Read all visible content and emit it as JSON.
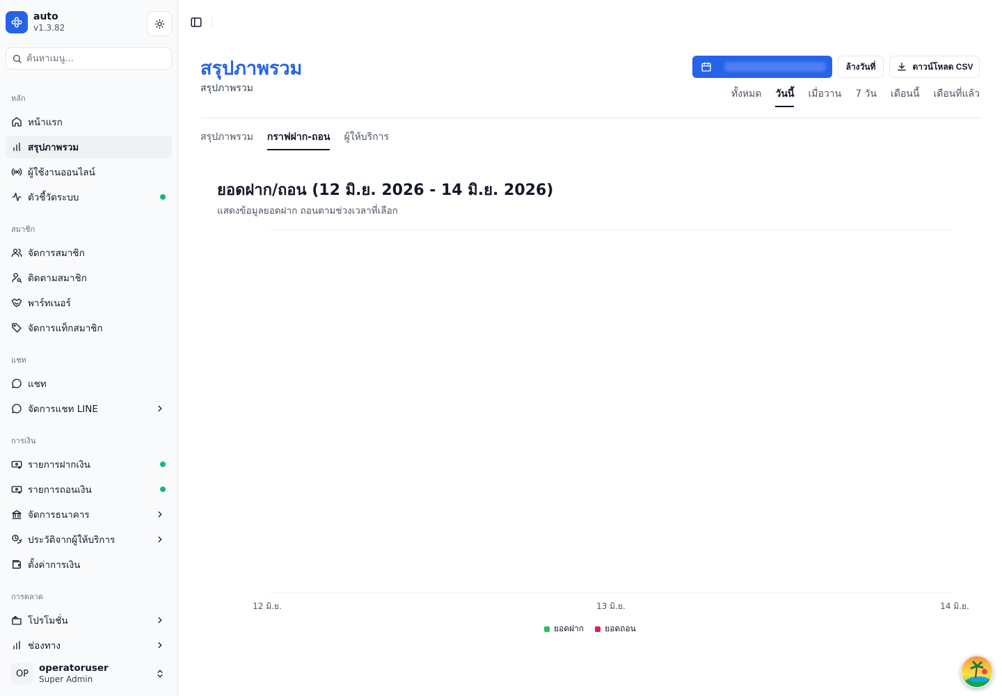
{
  "app": {
    "name": "auto",
    "version": "v1.3.82"
  },
  "search": {
    "placeholder": "ค้นหาเมนู..."
  },
  "sidebar": {
    "sections": [
      {
        "label": "หลัก"
      },
      {
        "label": "สมาชิก"
      },
      {
        "label": "แชท"
      },
      {
        "label": "การเงิน"
      },
      {
        "label": "การตลาด"
      }
    ],
    "items": [
      {
        "label": "หน้าแรก",
        "icon": "home-icon"
      },
      {
        "label": "สรุปภาพรวม",
        "icon": "bar-chart-icon",
        "active": true
      },
      {
        "label": "ผู้ใช้งานออนไลน์",
        "icon": "radio-icon"
      },
      {
        "label": "ตัวชี้วัดระบบ",
        "icon": "activity-icon",
        "dot": true
      },
      {
        "label": "จัดการสมาชิก",
        "icon": "users-icon"
      },
      {
        "label": "ติดตามสมาชิก",
        "icon": "user-search-icon"
      },
      {
        "label": "พาร์ทเนอร์",
        "icon": "handshake-icon"
      },
      {
        "label": "จัดการแท็กสมาชิก",
        "icon": "tag-icon"
      },
      {
        "label": "แชท",
        "icon": "message-circle-icon"
      },
      {
        "label": "จัดการแชท LINE",
        "icon": "message-circle-icon",
        "chevron": true
      },
      {
        "label": "รายการฝากเงิน",
        "icon": "deposit-icon",
        "dot": true
      },
      {
        "label": "รายการถอนเงิน",
        "icon": "withdraw-icon",
        "dot": true
      },
      {
        "label": "จัดการธนาคาร",
        "icon": "bank-icon",
        "chevron": true
      },
      {
        "label": "ประวัติจากผู้ให้บริการ",
        "icon": "history-icon",
        "chevron": true
      },
      {
        "label": "ตั้งค่าการเงิน",
        "icon": "wallet-icon"
      },
      {
        "label": "โปรโมชั่น",
        "icon": "gift-icon",
        "chevron": true
      },
      {
        "label": "ช่องทาง",
        "icon": "bar-chart-icon",
        "chevron": true
      }
    ]
  },
  "user": {
    "initials": "OP",
    "name": "operatoruser",
    "role": "Super Admin"
  },
  "header": {
    "title": "สรุปภาพรวม",
    "subtitle": "สรุปภาพรวม",
    "clear_label": "ล้างวันที่",
    "csv_label": "ดาวน์โหลด CSV",
    "range_tabs": [
      {
        "label": "ทั้งหมด"
      },
      {
        "label": "วันนี้",
        "active": true
      },
      {
        "label": "เมื่อวาน"
      },
      {
        "label": "7 วัน"
      },
      {
        "label": "เดือนนี้"
      },
      {
        "label": "เดือนที่แล้ว"
      }
    ]
  },
  "tabs": [
    {
      "label": "สรุปภาพรวม"
    },
    {
      "label": "กราฟฝาก-ถอน",
      "active": true
    },
    {
      "label": "ผู้ให้บริการ"
    }
  ],
  "chart": {
    "title": "ยอดฝาก/ถอน (12 มิ.ย. 2026 - 14 มิ.ย. 2026)",
    "description": "แสดงข้อมูลยอดฝาก ถอนตามช่วงเวลาที่เลือก"
  },
  "chart_data": {
    "type": "line",
    "x": [
      "12 มิ.ย.",
      "13 มิ.ย.",
      "14 มิ.ย."
    ],
    "series": [
      {
        "name": "ยอดฝาก",
        "color": "#22c55e",
        "values": []
      },
      {
        "name": "ยอดถอน",
        "color": "#e11d48",
        "values": []
      }
    ],
    "grid": true,
    "legend": "bottom-center"
  },
  "colors": {
    "accent": "#2563eb",
    "status_dot": "#10b981"
  }
}
